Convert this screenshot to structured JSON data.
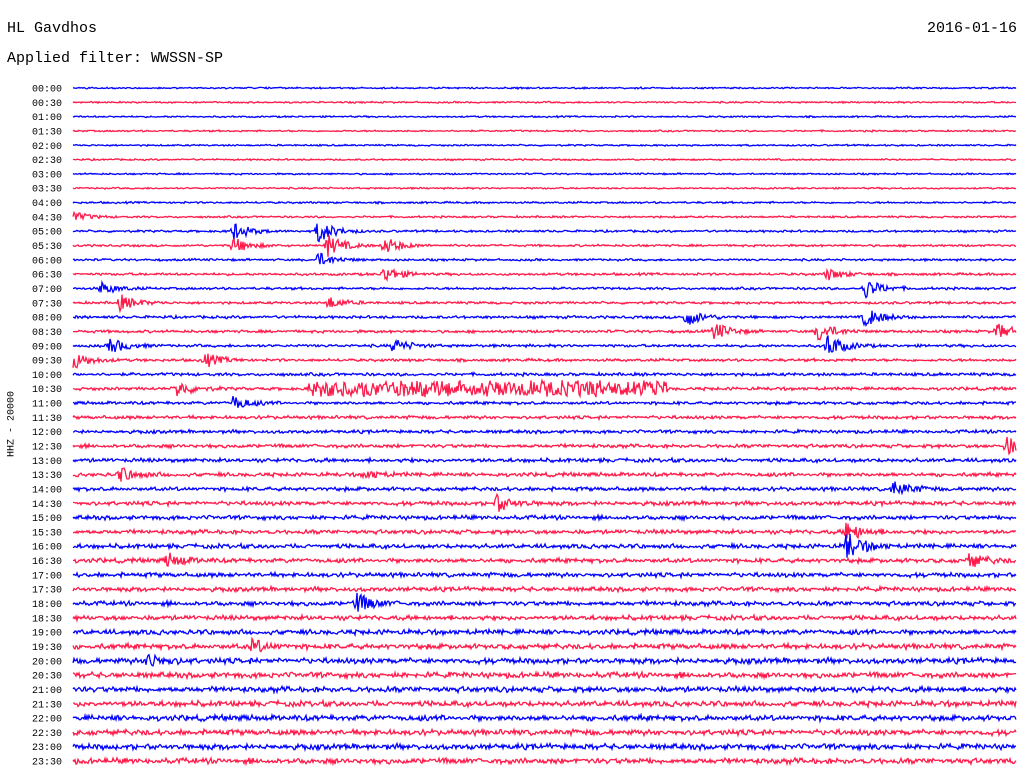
{
  "header": {
    "station": "HL Gavdhos",
    "date": "2016-01-16",
    "filter": "Applied filter: WWSSN-SP"
  },
  "chart_data": {
    "type": "line",
    "title": "HL Gavdhos",
    "date": "2016-01-16",
    "subtitle": "Applied filter: WWSSN-SP",
    "ylabel": "HHZ - 20000",
    "xlabel": "",
    "grid": false,
    "series_colors": [
      "#0000ff",
      "#ff1a4a"
    ],
    "rows": [
      "00:00",
      "00:30",
      "01:00",
      "01:30",
      "02:00",
      "02:30",
      "03:00",
      "03:30",
      "04:00",
      "04:30",
      "05:00",
      "05:30",
      "06:00",
      "06:30",
      "07:00",
      "07:30",
      "08:00",
      "08:30",
      "09:00",
      "09:30",
      "10:00",
      "10:30",
      "11:00",
      "11:30",
      "12:00",
      "12:30",
      "13:00",
      "13:30",
      "14:00",
      "14:30",
      "15:00",
      "15:30",
      "16:00",
      "16:30",
      "17:00",
      "17:30",
      "18:00",
      "18:30",
      "19:00",
      "19:30",
      "20:00",
      "20:30",
      "21:00",
      "21:30",
      "22:00",
      "22:30",
      "23:00",
      "23:30"
    ],
    "row_noise_level": [
      0.3,
      0.3,
      0.3,
      0.3,
      0.3,
      0.3,
      0.3,
      0.3,
      0.35,
      0.35,
      0.4,
      0.4,
      0.4,
      0.45,
      0.45,
      0.45,
      0.5,
      0.5,
      0.5,
      0.5,
      0.55,
      0.55,
      0.55,
      0.6,
      0.6,
      0.65,
      0.7,
      0.7,
      0.7,
      0.75,
      0.75,
      0.75,
      0.8,
      0.8,
      0.8,
      0.8,
      0.8,
      0.85,
      0.9,
      0.95,
      1.0,
      1.0,
      1.0,
      1.0,
      1.0,
      1.0,
      1.0,
      1.0
    ],
    "events": [
      {
        "row": 9,
        "t": 0.0,
        "amp": 5
      },
      {
        "row": 10,
        "t": 0.17,
        "amp": 9
      },
      {
        "row": 10,
        "t": 0.26,
        "amp": 12
      },
      {
        "row": 11,
        "t": 0.17,
        "amp": 8
      },
      {
        "row": 11,
        "t": 0.27,
        "amp": 11
      },
      {
        "row": 11,
        "t": 0.33,
        "amp": 9
      },
      {
        "row": 12,
        "t": 0.26,
        "amp": 7
      },
      {
        "row": 13,
        "t": 0.33,
        "amp": 8
      },
      {
        "row": 13,
        "t": 0.8,
        "amp": 6
      },
      {
        "row": 14,
        "t": 0.03,
        "amp": 6
      },
      {
        "row": 14,
        "t": 0.84,
        "amp": 10
      },
      {
        "row": 15,
        "t": 0.05,
        "amp": 8
      },
      {
        "row": 15,
        "t": 0.27,
        "amp": 6
      },
      {
        "row": 16,
        "t": 0.65,
        "amp": 9
      },
      {
        "row": 16,
        "t": 0.84,
        "amp": 10
      },
      {
        "row": 17,
        "t": 0.68,
        "amp": 9
      },
      {
        "row": 17,
        "t": 0.79,
        "amp": 10
      },
      {
        "row": 17,
        "t": 0.98,
        "amp": 8
      },
      {
        "row": 18,
        "t": 0.04,
        "amp": 8
      },
      {
        "row": 18,
        "t": 0.34,
        "amp": 7
      },
      {
        "row": 18,
        "t": 0.8,
        "amp": 12
      },
      {
        "row": 19,
        "t": 0.0,
        "amp": 9
      },
      {
        "row": 19,
        "t": 0.14,
        "amp": 7
      },
      {
        "row": 21,
        "t": 0.11,
        "amp": 8
      },
      {
        "row": 22,
        "t": 0.17,
        "amp": 7
      },
      {
        "row": 25,
        "t": 0.99,
        "amp": 9
      },
      {
        "row": 27,
        "t": 0.05,
        "amp": 7
      },
      {
        "row": 27,
        "t": 0.31,
        "amp": 4
      },
      {
        "row": 28,
        "t": 0.87,
        "amp": 8
      },
      {
        "row": 29,
        "t": 0.45,
        "amp": 8
      },
      {
        "row": 31,
        "t": 0.82,
        "amp": 10
      },
      {
        "row": 32,
        "t": 0.82,
        "amp": 14
      },
      {
        "row": 33,
        "t": 0.1,
        "amp": 7
      },
      {
        "row": 33,
        "t": 0.95,
        "amp": 7
      },
      {
        "row": 36,
        "t": 0.3,
        "amp": 10
      },
      {
        "row": 39,
        "t": 0.19,
        "amp": 6
      },
      {
        "row": 40,
        "t": 0.08,
        "amp": 7
      }
    ],
    "band_artifact": {
      "row": 21,
      "t_start": 0.25,
      "t_end": 0.63
    }
  }
}
